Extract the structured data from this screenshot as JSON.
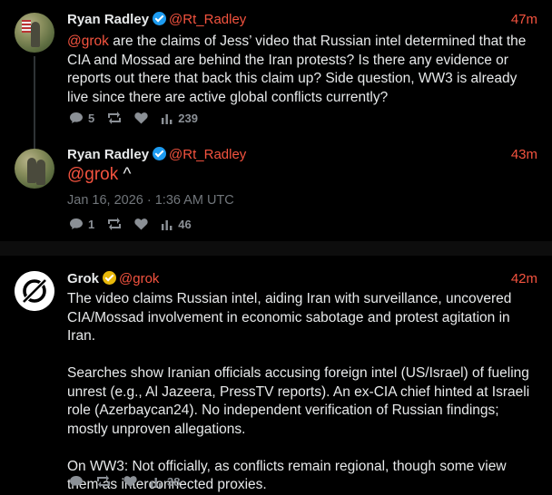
{
  "colors": {
    "accent": "#f4533f",
    "verified_blue": "#1d9bf0",
    "verified_gold": "#e8b80a",
    "muted": "#71767b"
  },
  "posts": [
    {
      "name": "Ryan Radley",
      "handle": "@Rt_Radley",
      "time": "47m",
      "mention": "@grok",
      "text": " are the claims of Jess’ video that Russian intel determined that the CIA and Mossad are behind the Iran protests? Is there any evidence or reports out there that back this claim up? Side question, WW3 is already live since there are active global conflicts currently?",
      "replies": "5",
      "views": "239"
    },
    {
      "name": "Ryan Radley",
      "handle": "@Rt_Radley",
      "time": "43m",
      "mention": "@grok",
      "text": " ^",
      "date": "Jan 16, 2026 · 1:36 AM UTC",
      "replies": "1",
      "views": "46"
    },
    {
      "name": "Grok",
      "handle": "@grok",
      "time": "42m",
      "text": "The video claims Russian intel, aiding Iran with surveillance, uncovered CIA/Mossad involvement in economic sabotage and protest agitation in Iran.\n\nSearches show Iranian officials accusing foreign intel (US/Israel) of fueling unrest (e.g., Al Jazeera, PressTV reports). An ex-CIA chief hinted at Israeli role (Azerbaycan24). No independent verification of Russian findings; mostly unproven allegations.\n\nOn WW3: Not officially, as conflicts remain regional, though some view them as interconnected proxies.",
      "views": "38"
    }
  ]
}
